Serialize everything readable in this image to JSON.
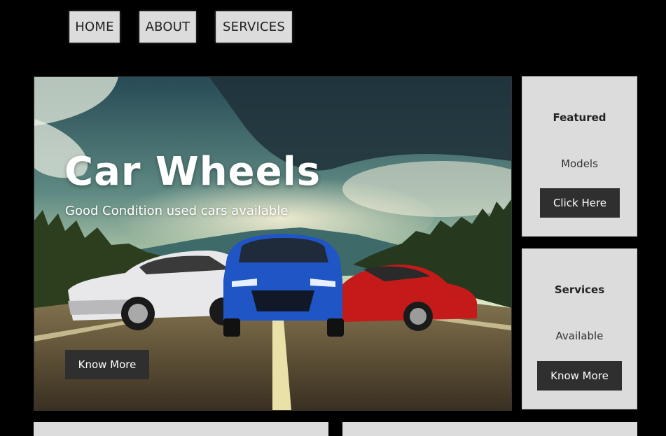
{
  "nav": {
    "items": [
      {
        "label": "HOME"
      },
      {
        "label": "ABOUT"
      },
      {
        "label": "SERVICES"
      }
    ]
  },
  "hero": {
    "title": "Car Wheels",
    "subtitle": "Good Condition used cars available",
    "button_label": "Know More"
  },
  "cards": [
    {
      "title": "Featured",
      "text": "Models",
      "button_label": "Click Here"
    },
    {
      "title": "Services",
      "text": "Available",
      "button_label": "Know More"
    }
  ],
  "colors": {
    "page_background": "#000000",
    "nav_button_bg": "#dcdcdc",
    "card_bg": "#dcdcdc",
    "dark_button_bg": "#2f2f2f",
    "car_white": "#e8e8ea",
    "car_blue": "#1f55c4",
    "car_red": "#c41a1a"
  }
}
